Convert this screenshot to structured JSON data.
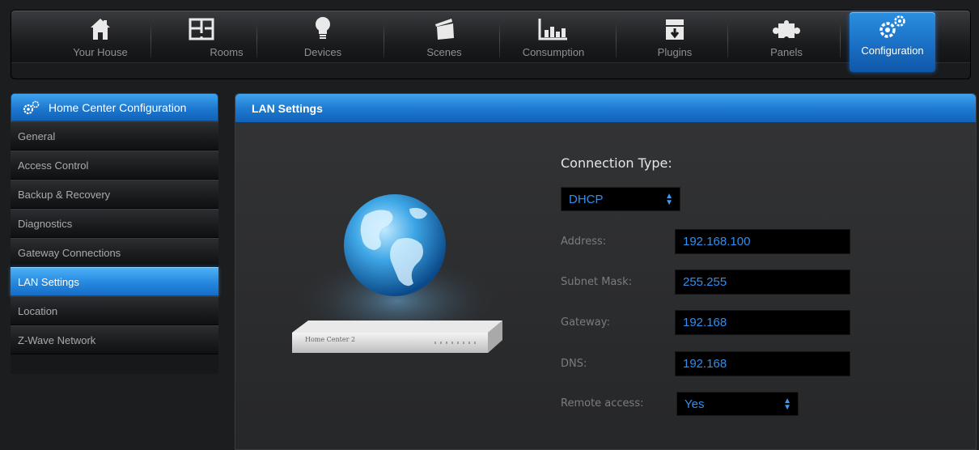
{
  "nav": {
    "items": [
      {
        "label": "Your House",
        "icon": "house-icon"
      },
      {
        "label": "Rooms",
        "icon": "rooms-icon"
      },
      {
        "label": "Devices",
        "icon": "bulb-icon"
      },
      {
        "label": "Scenes",
        "icon": "clapperboard-icon"
      },
      {
        "label": "Consumption",
        "icon": "bar-chart-icon"
      },
      {
        "label": "Plugins",
        "icon": "box-icon"
      },
      {
        "label": "Panels",
        "icon": "puzzle-icon"
      },
      {
        "label": "Configuration",
        "icon": "gears-icon"
      }
    ],
    "active": "Configuration"
  },
  "sidebar": {
    "title": "Home Center Configuration",
    "items": [
      {
        "label": "General"
      },
      {
        "label": "Access Control"
      },
      {
        "label": "Backup & Recovery"
      },
      {
        "label": "Diagnostics"
      },
      {
        "label": "Gateway Connections"
      },
      {
        "label": "LAN Settings"
      },
      {
        "label": "Location"
      },
      {
        "label": "Z-Wave Network"
      }
    ],
    "active": "LAN Settings"
  },
  "panel": {
    "title": "LAN Settings",
    "device_label": "Home Center 2",
    "connection_type_label": "Connection Type:",
    "connection_type_value": "DHCP",
    "fields": {
      "address": {
        "label": "Address:",
        "value": "192.168.100"
      },
      "subnet": {
        "label": "Subnet Mask:",
        "value": "255.255"
      },
      "gateway": {
        "label": "Gateway:",
        "value": "192.168"
      },
      "dns": {
        "label": "DNS:",
        "value": "192.168"
      }
    },
    "remote_access": {
      "label": "Remote access:",
      "value": "Yes"
    }
  },
  "colors": {
    "accent": "#1d78cf",
    "input_text": "#2f8ff0",
    "background": "#1c1d1f"
  }
}
